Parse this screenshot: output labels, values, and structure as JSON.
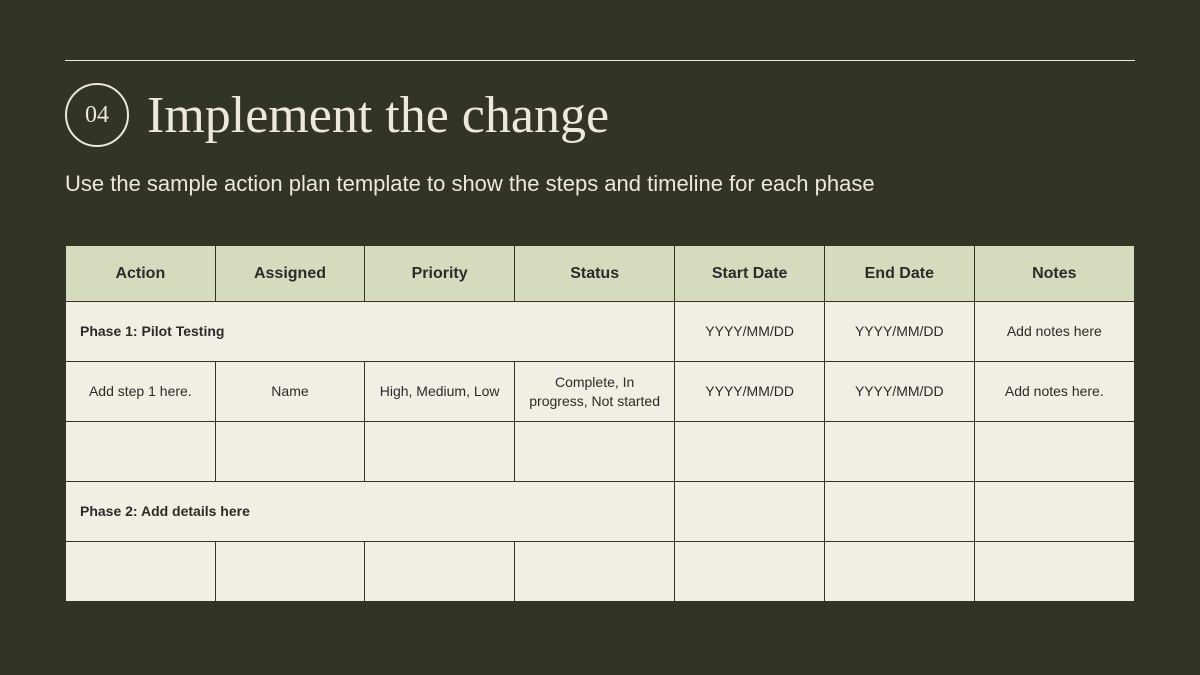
{
  "slide_number": "04",
  "title": "Implement the change",
  "subtitle": "Use the sample action plan template to show the steps and timeline for each phase",
  "headers": {
    "action": "Action",
    "assigned": "Assigned",
    "priority": "Priority",
    "status": "Status",
    "start": "Start Date",
    "end": "End Date",
    "notes": "Notes"
  },
  "rows": {
    "phase1": {
      "label": "Phase 1: Pilot Testing",
      "start": "YYYY/MM/DD",
      "end": "YYYY/MM/DD",
      "notes": "Add notes here"
    },
    "step1": {
      "action": "Add step 1 here.",
      "assigned": "Name",
      "priority": "High, Medium, Low",
      "status": "Complete, In progress, Not started",
      "start": "YYYY/MM/DD",
      "end": "YYYY/MM/DD",
      "notes": "Add notes here."
    },
    "phase2": {
      "label": "Phase 2: Add details here"
    }
  }
}
